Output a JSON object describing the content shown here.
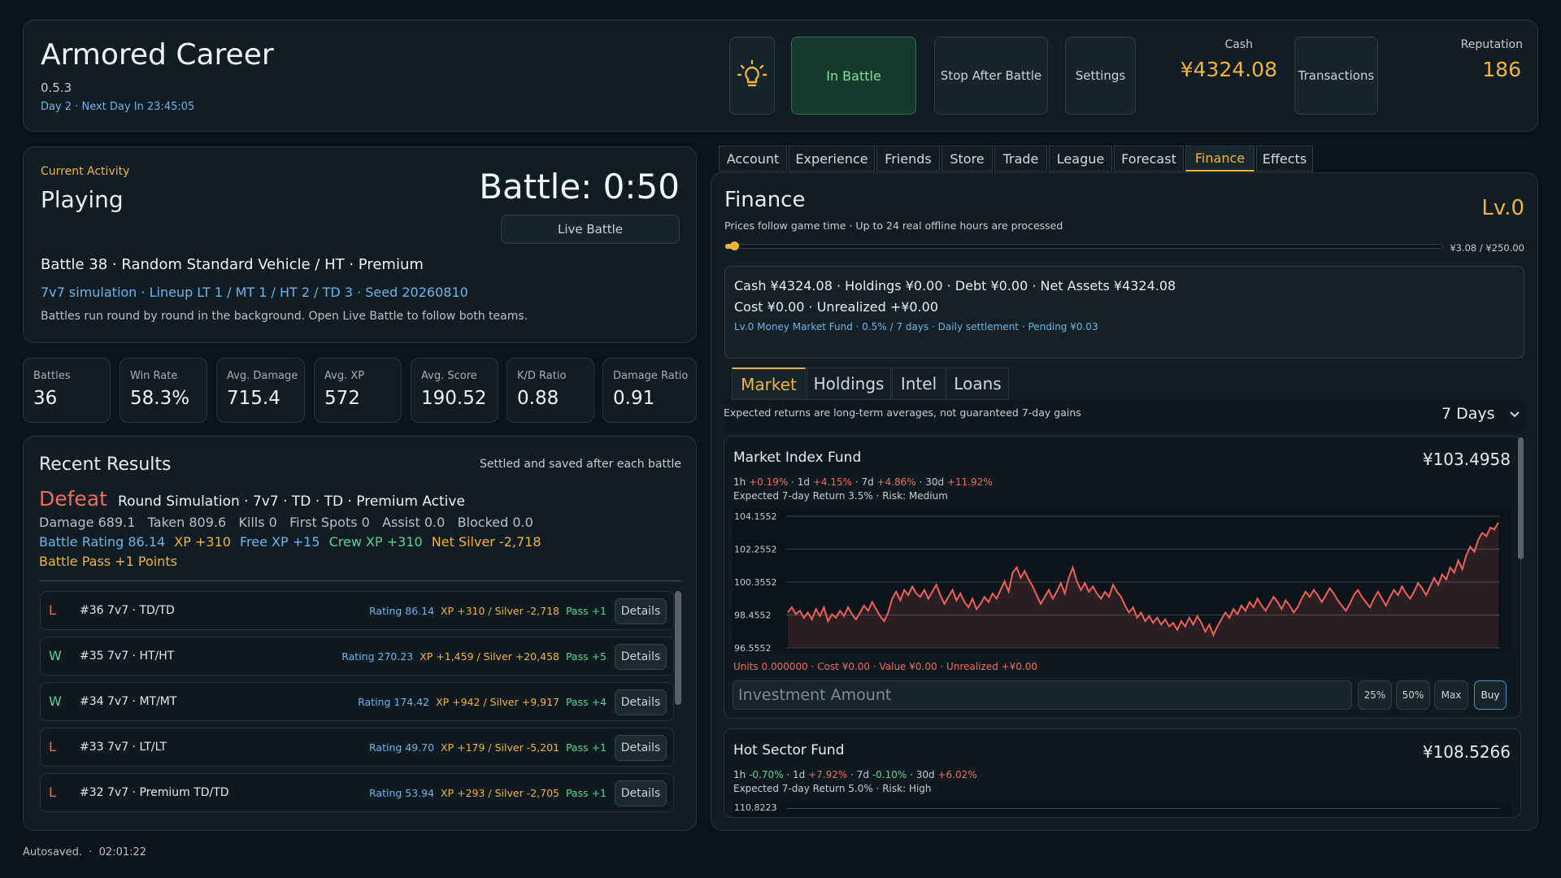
{
  "header": {
    "title": "Armored Career",
    "version": "0.5.3",
    "day_info": "Day 2 · Next Day In 23:45:05",
    "in_battle": "In Battle",
    "stop_after_battle": "Stop After Battle",
    "settings": "Settings",
    "cash_label": "Cash",
    "cash_value": "¥4324.08",
    "transactions": "Transactions",
    "reputation_label": "Reputation",
    "reputation_value": "186",
    "hint_icon": "lightbulb-icon"
  },
  "activity": {
    "label": "Current Activity",
    "status": "Playing",
    "battle_timer": "Battle: 0:50",
    "live_battle": "Live Battle",
    "battle_line": "Battle 38 · Random Standard Vehicle / HT · Premium",
    "sim_line": "7v7 simulation · Lineup LT 1 / MT 1 / HT 2 / TD 3 · Seed 20260810",
    "note": "Battles run round by round in the background. Open Live Battle to follow both teams."
  },
  "stats": [
    {
      "label": "Battles",
      "value": "36"
    },
    {
      "label": "Win Rate",
      "value": "58.3%"
    },
    {
      "label": "Avg. Damage",
      "value": "715.4"
    },
    {
      "label": "Avg. XP",
      "value": "572"
    },
    {
      "label": "Avg. Score",
      "value": "190.52"
    },
    {
      "label": "K/D Ratio",
      "value": "0.88"
    },
    {
      "label": "Damage Ratio",
      "value": "0.91"
    }
  ],
  "results": {
    "title": "Recent Results",
    "subtitle": "Settled and saved after each battle",
    "latest": {
      "outcome": "Defeat",
      "mode": "Round Simulation · 7v7 · TD · TD · Premium Active",
      "line1": "Damage 689.1   Taken 809.6   Kills 0   First Spots 0   Assist 0.0   Blocked 0.0",
      "rating": "Battle Rating 86.14",
      "xp": "XP +310",
      "free_xp": "Free XP +15",
      "crew_xp": "Crew XP +310",
      "net_silver": "Net Silver -2,718",
      "pass": "Battle Pass +1 Points"
    },
    "details_label": "Details",
    "rows": [
      {
        "wl": "L",
        "name": "#36  7v7 · TD/TD",
        "rating": "Rating 86.14",
        "xp": "XP +310 / Silver -2,718",
        "pass": "Pass +1"
      },
      {
        "wl": "W",
        "name": "#35  7v7 · HT/HT",
        "rating": "Rating 270.23",
        "xp": "XP +1,459 / Silver +20,458",
        "pass": "Pass +5"
      },
      {
        "wl": "W",
        "name": "#34  7v7 · MT/MT",
        "rating": "Rating 174.42",
        "xp": "XP +942 / Silver +9,917",
        "pass": "Pass +4"
      },
      {
        "wl": "L",
        "name": "#33  7v7 · LT/LT",
        "rating": "Rating 49.70",
        "xp": "XP +179 / Silver -5,201",
        "pass": "Pass +1"
      },
      {
        "wl": "L",
        "name": "#32  7v7 · Premium TD/TD",
        "rating": "Rating 53.94",
        "xp": "XP +293 / Silver -2,705",
        "pass": "Pass +1"
      }
    ]
  },
  "autosave": "Autosaved.  ·  02:01:22",
  "tabs": [
    "Account",
    "Experience",
    "Friends",
    "Store",
    "Trade",
    "League",
    "Forecast",
    "Finance",
    "Effects"
  ],
  "active_tab": "Finance",
  "finance": {
    "title": "Finance",
    "level": "Lv.0",
    "subtitle": "Prices follow game time · Up to 24 real offline hours are processed",
    "progress_text": "¥3.08 / ¥250.00",
    "progress_fraction": 0.0123,
    "summary_line1": "Cash ¥4324.08 · Holdings ¥0.00 · Debt ¥0.00 · Net Assets ¥4324.08",
    "summary_line2": "Cost ¥0.00 · Unrealized +¥0.00",
    "summary_line3": "Lv.0 Money Market Fund · 0.5% / 7 days · Daily settlement · Pending ¥0.03",
    "subtabs": [
      "Market",
      "Holdings",
      "Intel",
      "Loans"
    ],
    "active_subtab": "Market",
    "note": "Expected returns are long-term averages, not guaranteed 7-day gains",
    "period": "7 Days",
    "fund1": {
      "name": "Market Index Fund",
      "price": "¥103.4958",
      "perf_1h_label": "1h",
      "perf_1h": "+0.19%",
      "perf_1d_label": "1d",
      "perf_1d": "+4.15%",
      "perf_7d_label": "7d",
      "perf_7d": "+4.86%",
      "perf_30d_label": "30d",
      "perf_30d": "+11.92%",
      "expected": "Expected 7-day Return 3.5% · Risk: Medium",
      "position": "Units 0.000000 · Cost ¥0.00 · Value ¥0.00 · Unrealized +¥0.00",
      "amount_placeholder": "Investment Amount",
      "btn_25": "25%",
      "btn_50": "50%",
      "btn_max": "Max",
      "btn_buy": "Buy"
    },
    "fund2": {
      "name": "Hot Sector Fund",
      "price": "¥108.5266",
      "perf_1h_label": "1h",
      "perf_1h": "-0.70%",
      "perf_1d_label": "1d",
      "perf_1d": "+7.92%",
      "perf_7d_label": "7d",
      "perf_7d": "-0.10%",
      "perf_30d_label": "30d",
      "perf_30d": "+6.02%",
      "expected": "Expected 7-day Return 5.0% · Risk: High",
      "first_tick": "110.8223"
    }
  },
  "chart_data": {
    "type": "line",
    "title": "",
    "yticks": [
      "104.1552",
      "102.2552",
      "100.3552",
      "98.4552",
      "96.5552"
    ],
    "ylim": [
      96.5552,
      104.1552
    ],
    "color": "#f0605a",
    "values": [
      98.6,
      98.9,
      98.5,
      98.7,
      98.3,
      98.6,
      98.2,
      98.8,
      98.4,
      98.9,
      98.1,
      98.5,
      98.3,
      98.7,
      98.4,
      98.9,
      98.5,
      98.2,
      98.6,
      99.0,
      98.7,
      99.2,
      98.8,
      98.4,
      98.1,
      98.6,
      99.4,
      99.8,
      99.3,
      99.9,
      99.6,
      100.1,
      99.7,
      99.5,
      99.9,
      99.4,
      99.8,
      100.2,
      99.6,
      99.1,
      99.5,
      99.9,
      99.3,
      99.7,
      99.2,
      98.9,
      99.4,
      98.8,
      99.1,
      99.5,
      99.2,
      99.7,
      99.4,
      99.9,
      100.4,
      99.8,
      100.9,
      101.2,
      100.6,
      101.0,
      100.5,
      100.1,
      99.6,
      99.1,
      99.5,
      99.9,
      99.4,
      99.8,
      100.3,
      99.7,
      100.6,
      101.2,
      100.4,
      99.9,
      100.3,
      99.8,
      100.1,
      99.7,
      99.4,
      99.8,
      99.5,
      100.2,
      99.8,
      99.5,
      99.0,
      98.6,
      98.9,
      98.3,
      98.6,
      98.1,
      98.4,
      98.0,
      98.3,
      97.9,
      98.2,
      97.8,
      98.0,
      97.6,
      98.1,
      97.8,
      98.3,
      97.9,
      98.4,
      98.0,
      97.5,
      97.9,
      97.3,
      97.8,
      98.2,
      98.6,
      98.3,
      98.8,
      98.5,
      99.0,
      98.7,
      99.2,
      98.9,
      99.4,
      99.0,
      98.7,
      99.1,
      99.5,
      99.2,
      98.8,
      99.3,
      99.0,
      98.6,
      98.9,
      99.4,
      99.8,
      99.5,
      99.9,
      99.6,
      99.2,
      99.6,
      100.0,
      99.7,
      99.3,
      99.0,
      98.7,
      99.1,
      99.6,
      99.9,
      99.5,
      99.2,
      98.9,
      99.4,
      99.8,
      99.4,
      99.0,
      99.5,
      99.9,
      99.6,
      100.1,
      99.7,
      99.4,
      99.8,
      100.3,
      100.0,
      99.6,
      100.1,
      100.6,
      100.2,
      100.8,
      100.5,
      101.2,
      100.9,
      101.6,
      101.1,
      101.9,
      102.4,
      102.1,
      102.8,
      103.2,
      103.0,
      103.5,
      103.4,
      103.8
    ]
  }
}
